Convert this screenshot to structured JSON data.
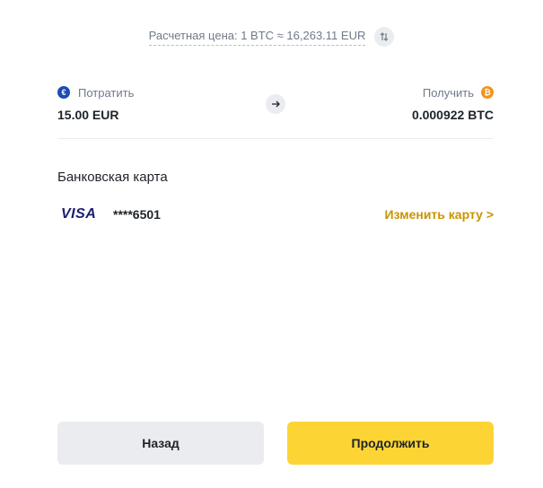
{
  "rate": {
    "text": "Расчетная цена: 1 BTC ≈ 16,263.11 EUR",
    "swap_icon": "swap-vertical-icon"
  },
  "spend": {
    "label": "Потратить",
    "value": "15.00 EUR",
    "coin_icon": "euro-coin-icon",
    "coin_glyph": "€",
    "coin_color": "#1b4db1"
  },
  "receive": {
    "label": "Получить",
    "value": "0.000922 BTC",
    "coin_icon": "bitcoin-coin-icon",
    "coin_glyph": "₿",
    "coin_color": "#f7931a"
  },
  "card": {
    "section_title": "Банковская карта",
    "brand": "VISA",
    "number": "****6501",
    "change_label": "Изменить карту >"
  },
  "buttons": {
    "back_label": "Назад",
    "continue_label": "Продолжить"
  },
  "colors": {
    "accent": "#fcd535",
    "link": "#c99400",
    "secondary_button": "#eaecef",
    "muted_text": "#707a8a",
    "visa_blue": "#1a1f71"
  }
}
